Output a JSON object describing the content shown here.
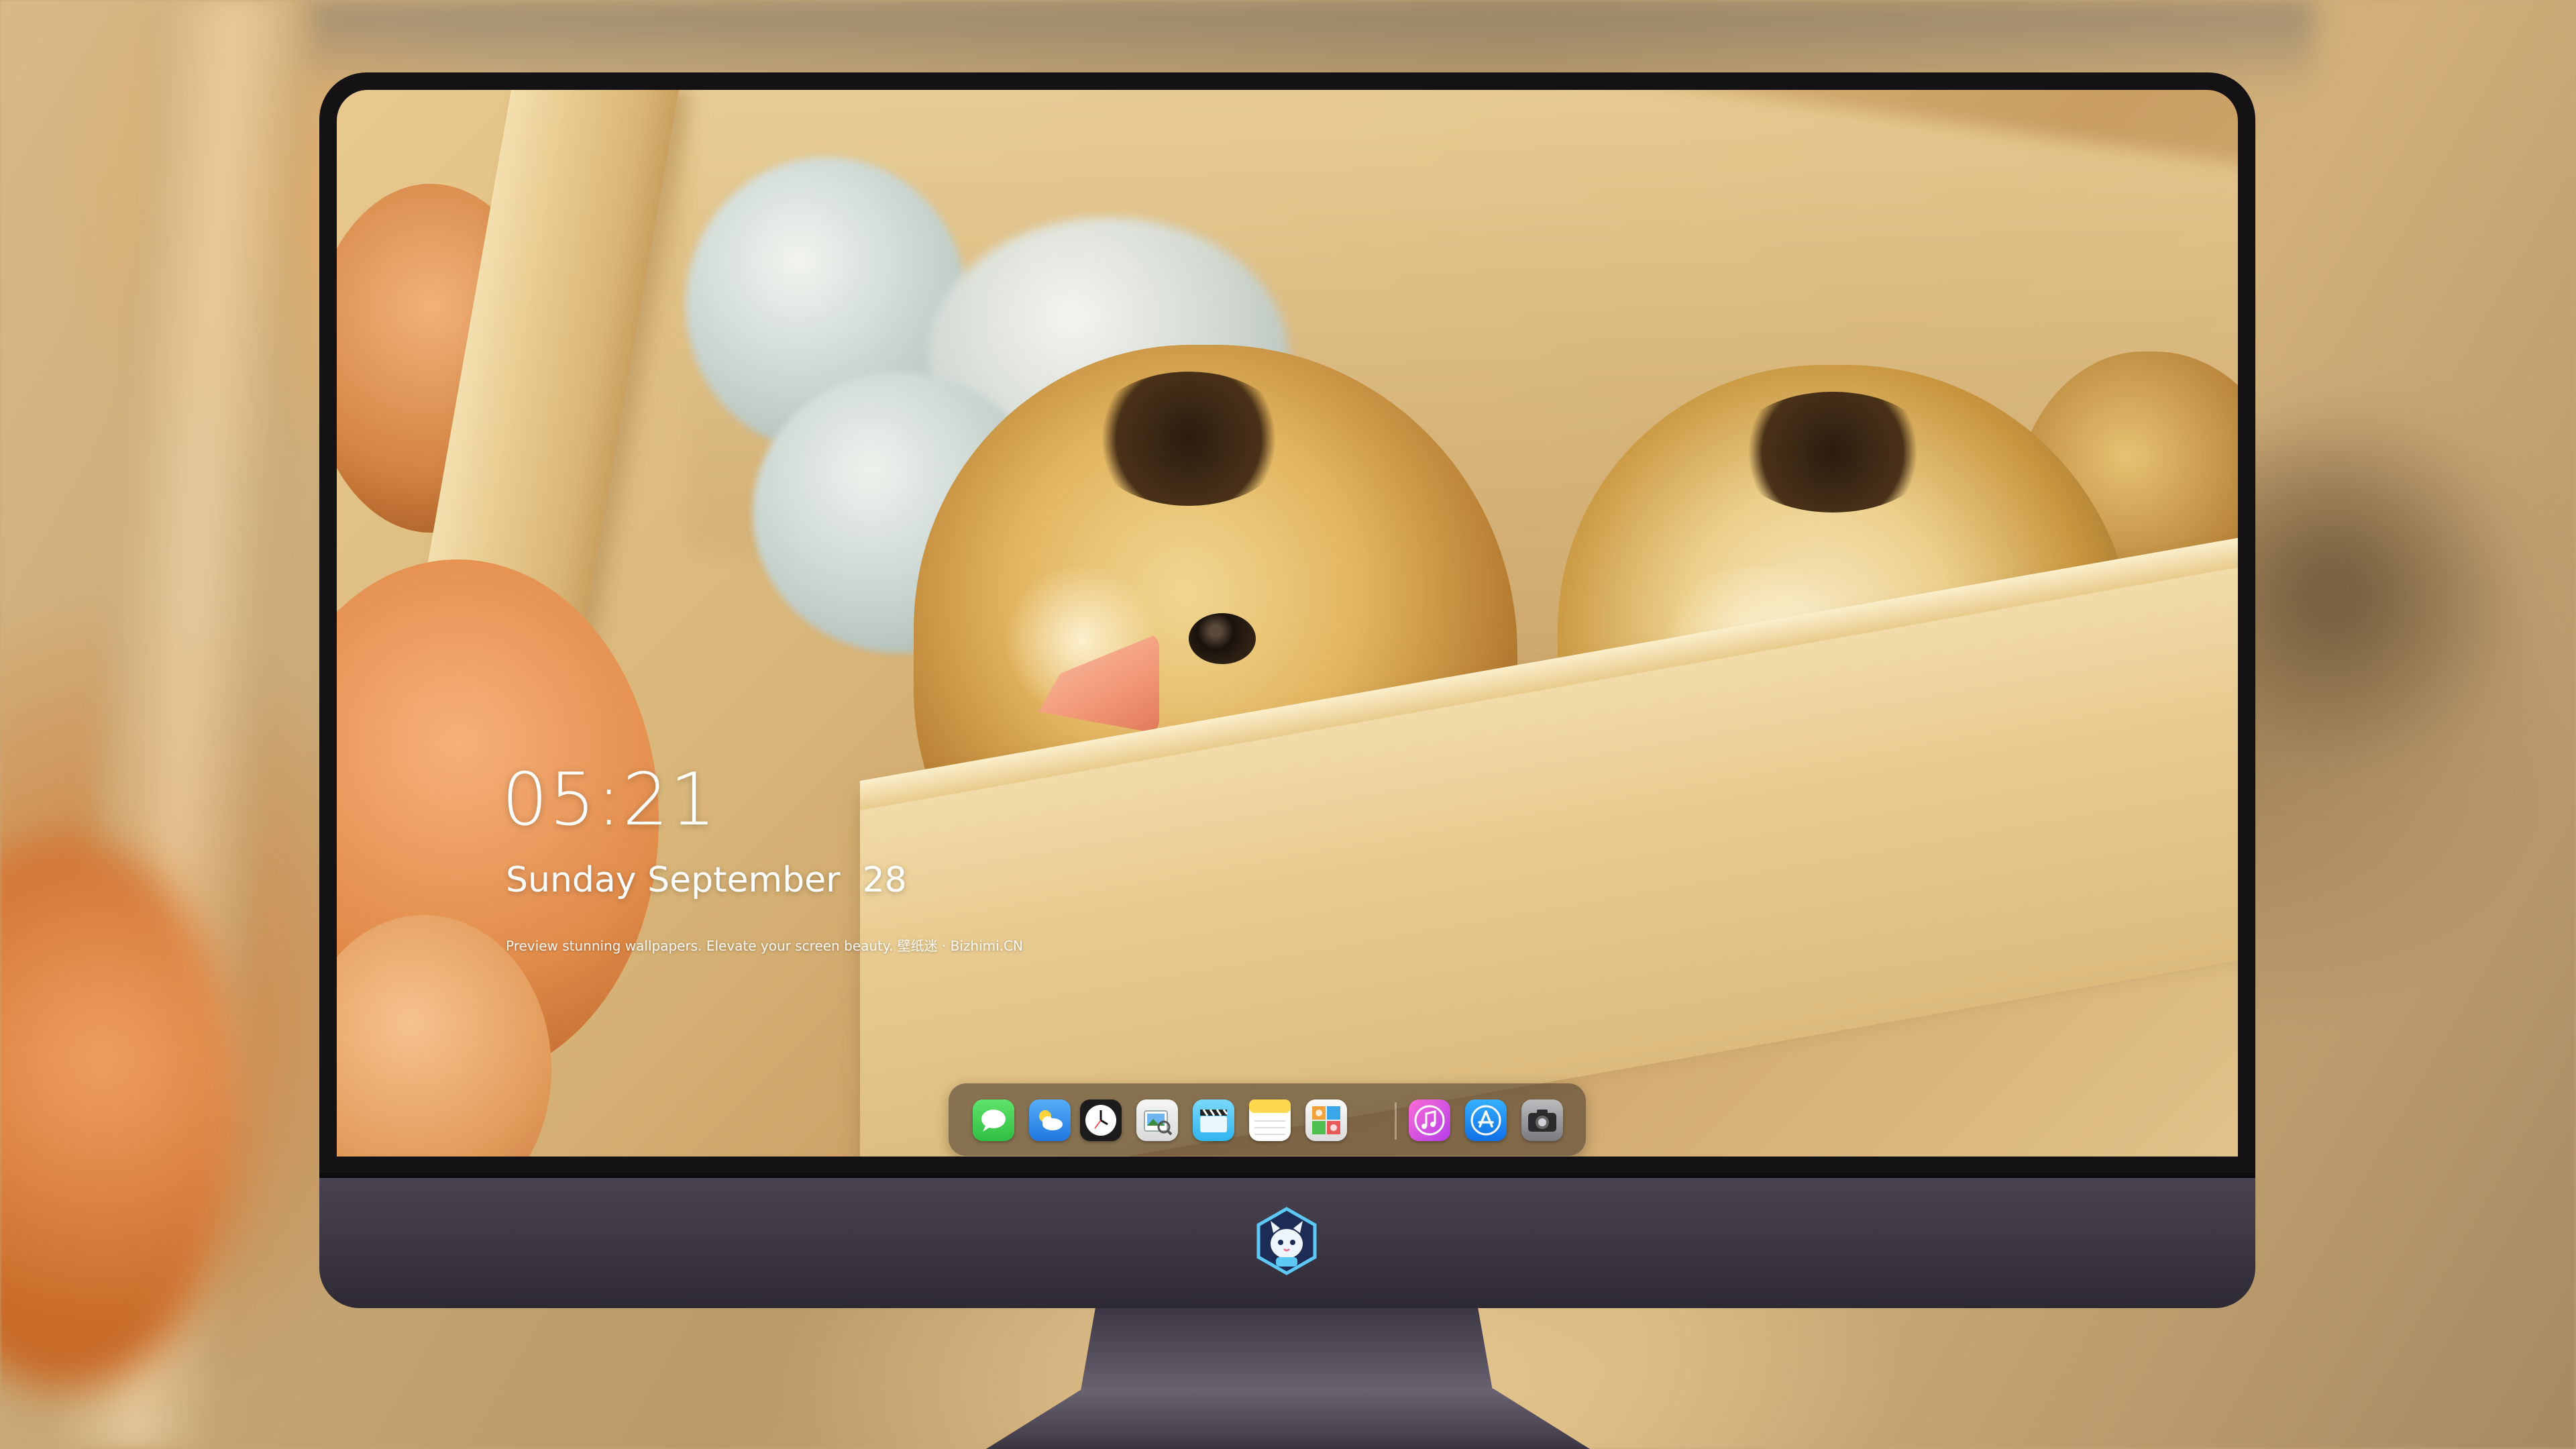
{
  "lock_screen": {
    "time": "05:21",
    "date": "Sunday September  28",
    "tagline": "Preview stunning wallpapers. Elevate your screen beauty. 壁纸迷 · Bizhimi.CN"
  },
  "dock": {
    "apps": [
      {
        "name": "Messages",
        "icon": "messages-icon",
        "color": "#3ccf4e"
      },
      {
        "name": "Weather",
        "icon": "weather-icon",
        "color": "#2f8ff0"
      },
      {
        "name": "Clock",
        "icon": "clock-icon",
        "color": "#1c1c1e"
      },
      {
        "name": "Preview",
        "icon": "preview-icon",
        "color": "#e6e6e6"
      },
      {
        "name": "Clips",
        "icon": "clapperboard-icon",
        "color": "#4fc6f4"
      },
      {
        "name": "Notes",
        "icon": "notes-icon",
        "color": "#ffd84d"
      },
      {
        "name": "Photo Booth",
        "icon": "photo-booth-icon",
        "color": "#f4f4f4"
      },
      {
        "name": "iTunes",
        "icon": "music-icon",
        "color": "#e94be0"
      },
      {
        "name": "App Store",
        "icon": "app-store-icon",
        "color": "#1d8bf0"
      },
      {
        "name": "Camera",
        "icon": "camera-icon",
        "color": "#8d8d8f"
      }
    ]
  },
  "monitor": {
    "bezel_color": "#141215",
    "chin_color": "#3a3541",
    "brand_logo": "cat-mascot-logo"
  }
}
